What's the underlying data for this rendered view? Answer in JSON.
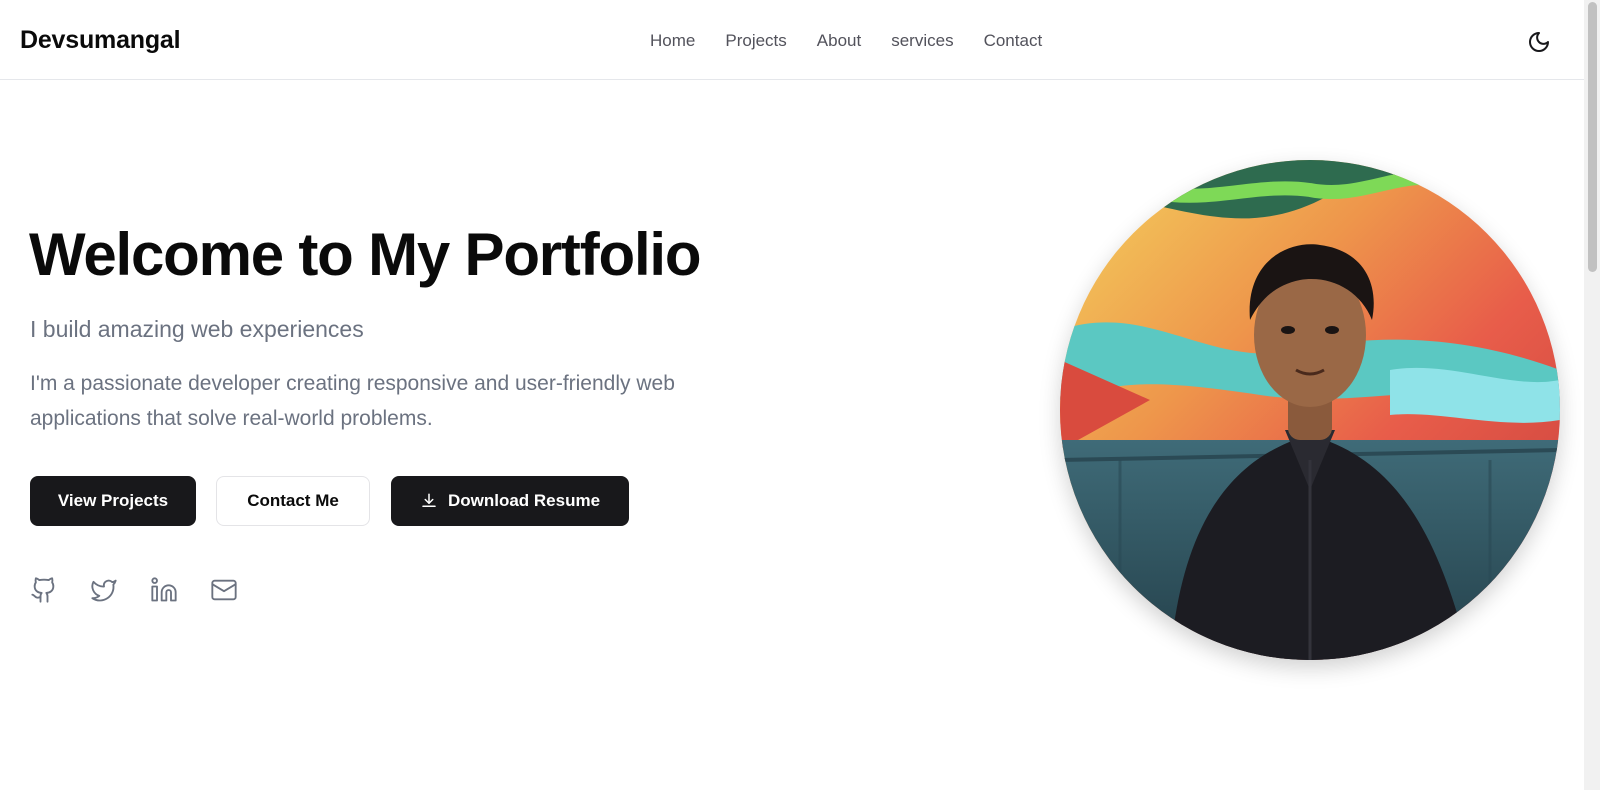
{
  "header": {
    "brand": "Devsumangal",
    "nav": [
      "Home",
      "Projects",
      "About",
      "services",
      "Contact"
    ],
    "theme_toggle_icon": "moon-icon"
  },
  "hero": {
    "title": "Welcome to My Portfolio",
    "subtitle": "I build amazing web experiences",
    "description": "I'm a passionate developer creating responsive and user-friendly web applications that solve real-world problems.",
    "buttons": {
      "view_projects": "View Projects",
      "contact_me": "Contact Me",
      "download_resume": "Download Resume"
    },
    "socials": [
      "github-icon",
      "twitter-icon",
      "linkedin-icon",
      "mail-icon"
    ]
  },
  "profile": {
    "image": "profile-photo"
  },
  "colors": {
    "text_primary": "#0a0a0a",
    "text_muted": "#6b7280",
    "button_dark": "#18181b",
    "border": "#e5e7eb"
  }
}
